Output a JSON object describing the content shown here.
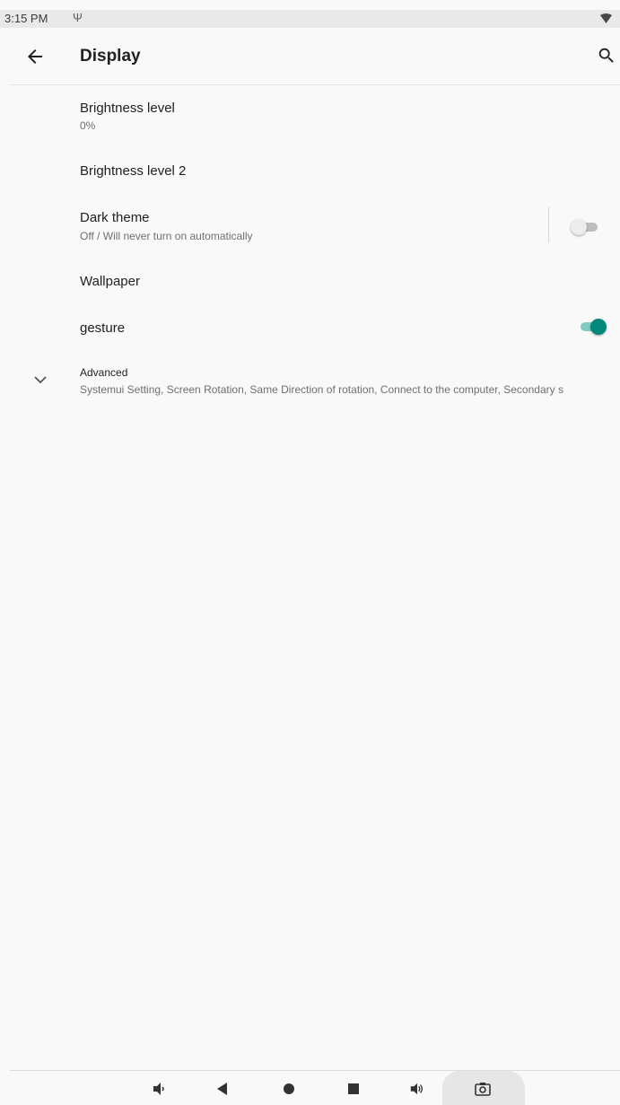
{
  "status_bar": {
    "time": "3:15 PM"
  },
  "app_bar": {
    "title": "Display"
  },
  "preferences": {
    "brightness_level": {
      "title": "Brightness level",
      "summary": "0%"
    },
    "brightness_level_2": {
      "title": "Brightness level 2"
    },
    "dark_theme": {
      "title": "Dark theme",
      "summary": "Off / Will never turn on automatically",
      "enabled": false
    },
    "wallpaper": {
      "title": "Wallpaper"
    },
    "gesture": {
      "title": "gesture",
      "enabled": true
    },
    "advanced": {
      "title": "Advanced",
      "summary": "Systemui Setting, Screen Rotation, Same Direction of rotation, Connect to the computer, Secondary s"
    }
  },
  "colors": {
    "accent": "#00897b",
    "accent_track": "#80cbc4",
    "toggle_off_thumb": "#ececec",
    "toggle_off_track": "#bdbdbd"
  },
  "icons": {
    "status": [
      "usb-icon",
      "wifi-icon"
    ],
    "app_bar": [
      "arrow-back-icon",
      "search-icon"
    ],
    "nav_bar": [
      "volume-down-icon",
      "back-triangle-icon",
      "home-circle-icon",
      "recents-square-icon",
      "volume-up-icon",
      "camera-icon"
    ]
  }
}
